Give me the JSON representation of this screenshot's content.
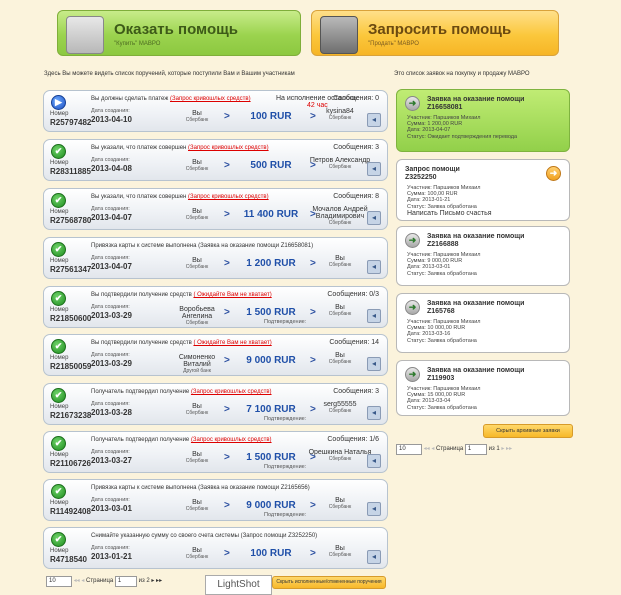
{
  "top": {
    "give": {
      "title": "Оказать помощь",
      "sub": "\"Купить\" МАВРО"
    },
    "ask": {
      "title": "Запросить помощь",
      "sub": "\"Продать\" МАВРО"
    }
  },
  "intro_left": "Здесь Вы можете видеть список поручений, которые поступили Вам и Вашим участникам",
  "intro_right": "Это список заявок на покупку и продажу МАВРО",
  "labels": {
    "number": "Номер",
    "created": "Дата создания:",
    "messages": "Сообщения:",
    "confirmation": "Подтверждение:"
  },
  "items": [
    {
      "status": "play",
      "head": "Вы должны сделать платеж",
      "link": "(Запрос кривошлых средств)",
      "remain_label": "На исполнение осталось:",
      "remain": "42 час",
      "msg": "Сообщения: 0",
      "num": "R25797482",
      "date": "2013-04-10",
      "from": "Вы",
      "from_bank": "Сбербанк",
      "amount": "100 RUR",
      "to": "kysina84",
      "to_bank": "Сбербанк"
    },
    {
      "status": "ok",
      "head": "Вы указали, что платеж совершен",
      "link": "(Запрос кривошлых средств)",
      "msg": "Сообщения: 3",
      "num": "R28311885",
      "date": "2013-04-08",
      "from": "Вы",
      "from_bank": "Сбербанк",
      "amount": "500 RUR",
      "to": "Петров Александр",
      "to_bank": "Сбербанк"
    },
    {
      "status": "ok",
      "head": "Вы указали, что платеж совершен",
      "link": "(Запрос кривошлых средств)",
      "msg": "Сообщения: 8",
      "num": "R27568780",
      "date": "2013-04-07",
      "from": "Вы",
      "from_bank": "Сбербанк",
      "amount": "11 400 RUR",
      "to": "Мочалов Андрей Владимирович",
      "to_bank": "Сбербанк"
    },
    {
      "status": "ok",
      "head": "Привязка карты к системе выполнена (Заявка на оказание помощи Z16658081)",
      "link": "",
      "msg": "",
      "num": "R27561347",
      "date": "2013-04-07",
      "from": "Вы",
      "from_bank": "Сбербанк",
      "amount": "1 200 RUR",
      "to": "Вы",
      "to_bank": "Сбербанк"
    },
    {
      "status": "ok",
      "head": "Вы подтвердили получение средств",
      "link": "( Ожидайте Вам не хватает)",
      "msg": "Сообщения: 0/3",
      "num": "R21850600",
      "date": "2013-03-29",
      "from": "Воробьева Ангелина",
      "from_bank": "Сбербанк",
      "amount": "1 500 RUR",
      "to": "Вы",
      "to_bank": "Сбербанк",
      "conf": true
    },
    {
      "status": "ok",
      "head": "Вы подтвердили получение средств",
      "link": "( Ожидайте Вам не хватает)",
      "msg": "Сообщения: 14",
      "num": "R21850059",
      "date": "2013-03-29",
      "from": "Симоненко Виталий",
      "from_bank": "Другой банк",
      "amount": "9 000 RUR",
      "to": "Вы",
      "to_bank": "Сбербанк"
    },
    {
      "status": "ok",
      "head": "Получатель подтвердил получение",
      "link": "(Запрос кривошлых средств)",
      "msg": "Сообщения: 3",
      "num": "R21673238",
      "date": "2013-03-28",
      "from": "Вы",
      "from_bank": "Сбербанк",
      "amount": "7 100 RUR",
      "to": "serg55555",
      "to_bank": "Сбербанк",
      "conf": true
    },
    {
      "status": "ok",
      "head": "Получатель подтвердил получение",
      "link": "(Запрос кривошлых средств)",
      "msg": "Сообщения: 1/6",
      "num": "R21106726",
      "date": "2013-03-27",
      "from": "Вы",
      "from_bank": "Сбербанк",
      "amount": "1 500 RUR",
      "to": "Орешкина Наталья",
      "to_bank": "Сбербанк",
      "conf": true
    },
    {
      "status": "ok",
      "head": "Привязка карты к системе выполнена (Заявка на оказание помощи Z2165656)",
      "link": "",
      "msg": "",
      "num": "R11492408",
      "date": "2013-03-01",
      "from": "Вы",
      "from_bank": "Сбербанк",
      "amount": "9 000 RUR",
      "to": "Вы",
      "to_bank": "Сбербанк",
      "conf": true
    },
    {
      "status": "ok",
      "head": "Снимайте указанную сумму со своего счета системы (Запрос помощи Z3252250)",
      "link": "",
      "msg": "",
      "num": "R4718540",
      "date": "2013-01-21",
      "from": "Вы",
      "from_bank": "Сбербанк",
      "amount": "100 RUR",
      "to": "Вы",
      "to_bank": "Сбербанк"
    }
  ],
  "pager": {
    "per_page": "10",
    "page_label": "Страница",
    "page": "1",
    "of": "из 2"
  },
  "lightshot": "LightShot",
  "bottom_button": "Скрыть исполненные/отмененные поручения",
  "cards": [
    {
      "active": true,
      "title": "Заявка на оказание помощи",
      "num": "Z16658081",
      "participant": "Участник: Паршиков Михаил",
      "sum": "Сумма: 1 200,00 RUR",
      "date": "Дата: 2013-04-07",
      "status": "Статус: Ожидает подтверждения перевода"
    },
    {
      "active": false,
      "plain": true,
      "title": "Запрос помощи",
      "num": "Z3252250",
      "participant": "Участник: Паршиков Михаил",
      "sum": "Сумма: 100,00 RUR",
      "date": "Дата: 2013-01-21",
      "status": "Статус: Заявка обработана",
      "write": "Написать Письмо счастья"
    },
    {
      "active": false,
      "title": "Заявка на оказание помощи",
      "num": "Z2166888",
      "participant": "Участник: Паршиков Михаил",
      "sum": "Сумма: 9 000,00 RUR",
      "date": "Дата: 2013-03-01",
      "status": "Статус: Заявка обработана"
    },
    {
      "active": false,
      "title": "Заявка на оказание помощи",
      "num": "Z165768",
      "participant": "Участник: Паршиков Михаил",
      "sum": "Сумма: 10 000,00 RUR",
      "date": "Дата: 2013-03-16",
      "status": "Статус: Заявка обработана"
    },
    {
      "active": false,
      "title": "Заявка на оказание помощи",
      "num": "Z119903",
      "participant": "Участник: Паршиков Михаил",
      "sum": "Сумма: 15 000,00 RUR",
      "date": "Дата: 2013-03-04",
      "status": "Статус: Заявка обработана"
    }
  ],
  "right_button": "Скрыть архивные заявки",
  "right_pager": {
    "per_page": "10",
    "page_label": "Страница",
    "page": "1",
    "of": "из 1"
  }
}
